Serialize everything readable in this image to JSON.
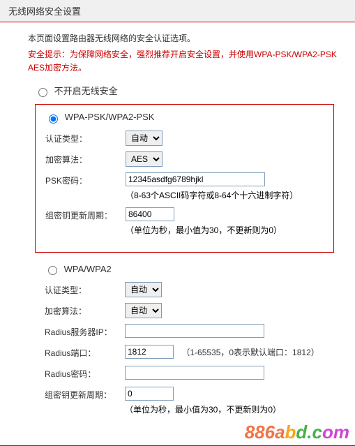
{
  "header": {
    "title": "无线网络安全设置"
  },
  "intro": "本页面设置路由器无线网络的安全认证选项。",
  "warning": "安全提示：为保障网络安全，强烈推荐开启安全设置，并使用WPA-PSK/WPA2-PSK AES加密方法。",
  "security_options": {
    "disable_label": "不开启无线安全",
    "wpa_psk_label": "WPA-PSK/WPA2-PSK",
    "wpa_label": "WPA/WPA2"
  },
  "wpa_psk": {
    "auth_type_label": "认证类型：",
    "auth_type_value": "自动",
    "cipher_label": "加密算法：",
    "cipher_value": "AES",
    "psk_label": "PSK密码：",
    "psk_value": "12345asdfg6789hjkl",
    "psk_hint": "（8-63个ASCII码字符或8-64个十六进制字符）",
    "gk_label": "组密钥更新周期：",
    "gk_value": "86400",
    "gk_hint": "（单位为秒，最小值为30，不更新则为0）"
  },
  "wpa": {
    "auth_type_label": "认证类型：",
    "auth_type_value": "自动",
    "cipher_label": "加密算法：",
    "cipher_value": "自动",
    "radius_ip_label": "Radius服务器IP：",
    "radius_ip_value": "",
    "radius_port_label": "Radius端口：",
    "radius_port_value": "1812",
    "radius_port_hint": "（1-65535，0表示默认端口：1812）",
    "radius_pw_label": "Radius密码：",
    "radius_pw_value": "",
    "gk_label": "组密钥更新周期：",
    "gk_value": "0",
    "gk_hint": "（单位为秒，最小值为30，不更新则为0）"
  },
  "watermark": {
    "p1": "886a",
    "p2": "b",
    "p3": "d.c",
    "p4": "om"
  }
}
